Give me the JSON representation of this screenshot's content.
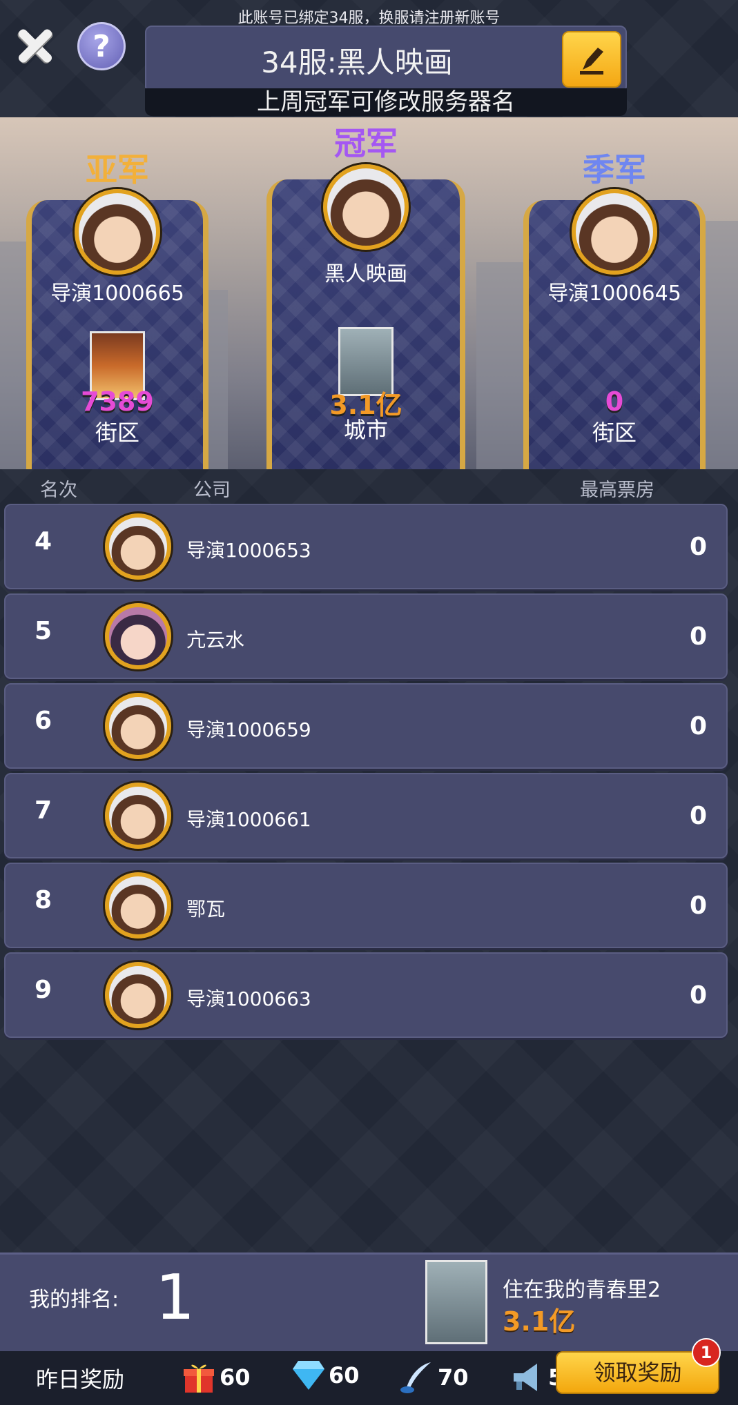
{
  "header": {
    "notice": "此账号已绑定34服，换服请注册新账号",
    "server_name": "34服:黑人映画",
    "server_subtitle": "上周冠军可修改服务器名"
  },
  "podium": {
    "second": {
      "title": "亚军",
      "name": "导演1000665",
      "value": "7389",
      "area": "街区",
      "title_color": "#f2b03a",
      "value_color": "#e64bd6"
    },
    "first": {
      "title": "冠军",
      "name": "黑人映画",
      "value": "3.1亿",
      "area": "城市",
      "title_color": "#a457f2",
      "value_color": "#f39a26"
    },
    "third": {
      "title": "季军",
      "name": "导演1000645",
      "value": "0",
      "area": "街区",
      "title_color": "#6f86f0",
      "value_color": "#e64bd6"
    }
  },
  "columns": {
    "rank": "名次",
    "company": "公司",
    "box_office": "最高票房"
  },
  "rows": [
    {
      "rank": "4",
      "name": "导演1000653",
      "value": "0"
    },
    {
      "rank": "5",
      "name": "亢云水",
      "value": "0"
    },
    {
      "rank": "6",
      "name": "导演1000659",
      "value": "0"
    },
    {
      "rank": "7",
      "name": "导演1000661",
      "value": "0"
    },
    {
      "rank": "8",
      "name": "鄂瓦",
      "value": "0"
    },
    {
      "rank": "9",
      "name": "导演1000663",
      "value": "0"
    }
  ],
  "my_rank": {
    "label": "我的排名:",
    "value": "1",
    "movie_title": "住在我的青春里2",
    "movie_box_office": "3.1亿"
  },
  "rewards": {
    "label": "昨日奖励",
    "items": [
      {
        "icon": "gift-icon",
        "amount": "60"
      },
      {
        "icon": "diamond-icon",
        "amount": "60"
      },
      {
        "icon": "quill-icon",
        "amount": "70"
      },
      {
        "icon": "megaphone-icon",
        "amount": "5"
      }
    ],
    "claim_label": "领取奖励",
    "claim_badge": "1"
  },
  "colors": {
    "accent_gold": "#f4a713",
    "panel": "#474a6d",
    "background": "#222836"
  }
}
